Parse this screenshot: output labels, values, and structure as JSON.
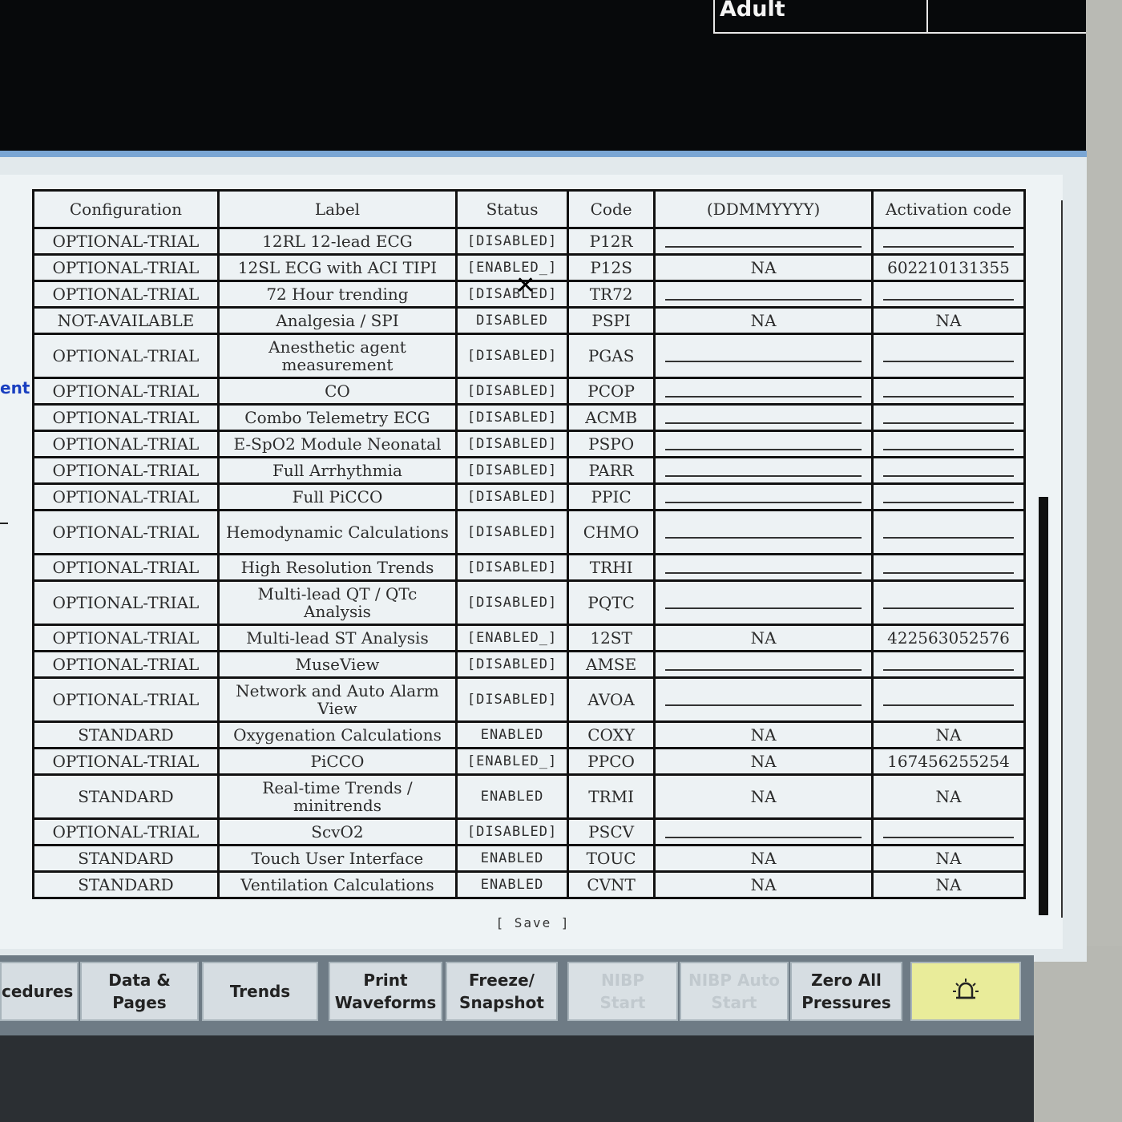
{
  "header": {
    "patient_type": "Adult"
  },
  "side": {
    "fragment": "ent"
  },
  "table": {
    "headers": {
      "configuration": "Configuration",
      "label": "Label",
      "status": "Status",
      "code": "Code",
      "expiration": "(DDMMYYYY)",
      "activation": "Activation code"
    },
    "rows": [
      {
        "config": "OPTIONAL-TRIAL",
        "label": "12RL 12-lead ECG",
        "status": "[DISABLED]",
        "code": "P12R",
        "expiration": "",
        "activation": ""
      },
      {
        "config": "OPTIONAL-TRIAL",
        "label": "12SL ECG with ACI TIPI",
        "status": "[ENABLED_]",
        "code": "P12S",
        "expiration": "NA",
        "activation": "602210131355"
      },
      {
        "config": "OPTIONAL-TRIAL",
        "label": "72 Hour trending",
        "status": "[DISABLED]",
        "code": "TR72",
        "expiration": "",
        "activation": ""
      },
      {
        "config": "NOT-AVAILABLE",
        "label": "Analgesia / SPI",
        "status": "DISABLED",
        "code": "PSPI",
        "expiration": "NA",
        "activation": "NA"
      },
      {
        "config": "OPTIONAL-TRIAL",
        "label": "Anesthetic agent measurement",
        "status": "[DISABLED]",
        "code": "PGAS",
        "expiration": "",
        "activation": ""
      },
      {
        "config": "OPTIONAL-TRIAL",
        "label": "CO",
        "status": "[DISABLED]",
        "code": "PCOP",
        "expiration": "",
        "activation": ""
      },
      {
        "config": "OPTIONAL-TRIAL",
        "label": "Combo Telemetry ECG",
        "status": "[DISABLED]",
        "code": "ACMB",
        "expiration": "",
        "activation": ""
      },
      {
        "config": "OPTIONAL-TRIAL",
        "label": "E-SpO2 Module Neonatal",
        "status": "[DISABLED]",
        "code": "PSPO",
        "expiration": "",
        "activation": ""
      },
      {
        "config": "OPTIONAL-TRIAL",
        "label": "Full Arrhythmia",
        "status": "[DISABLED]",
        "code": "PARR",
        "expiration": "",
        "activation": ""
      },
      {
        "config": "OPTIONAL-TRIAL",
        "label": "Full PiCCO",
        "status": "[DISABLED]",
        "code": "PPIC",
        "expiration": "",
        "activation": ""
      },
      {
        "config": "OPTIONAL-TRIAL",
        "label": "Hemodynamic Calculations",
        "status": "[DISABLED]",
        "code": "CHMO",
        "expiration": "",
        "activation": ""
      },
      {
        "config": "OPTIONAL-TRIAL",
        "label": "High Resolution Trends",
        "status": "[DISABLED]",
        "code": "TRHI",
        "expiration": "",
        "activation": ""
      },
      {
        "config": "OPTIONAL-TRIAL",
        "label": "Multi-lead QT / QTc Analysis",
        "status": "[DISABLED]",
        "code": "PQTC",
        "expiration": "",
        "activation": ""
      },
      {
        "config": "OPTIONAL-TRIAL",
        "label": "Multi-lead ST Analysis",
        "status": "[ENABLED_]",
        "code": "12ST",
        "expiration": "NA",
        "activation": "422563052576"
      },
      {
        "config": "OPTIONAL-TRIAL",
        "label": "MuseView",
        "status": "[DISABLED]",
        "code": "AMSE",
        "expiration": "",
        "activation": ""
      },
      {
        "config": "OPTIONAL-TRIAL",
        "label": "Network and Auto Alarm View",
        "status": "[DISABLED]",
        "code": "AVOA",
        "expiration": "",
        "activation": ""
      },
      {
        "config": "STANDARD",
        "label": "Oxygenation Calculations",
        "status": "ENABLED",
        "code": "COXY",
        "expiration": "NA",
        "activation": "NA"
      },
      {
        "config": "OPTIONAL-TRIAL",
        "label": "PiCCO",
        "status": "[ENABLED_]",
        "code": "PPCO",
        "expiration": "NA",
        "activation": "167456255254"
      },
      {
        "config": "STANDARD",
        "label": "Real-time Trends / minitrends",
        "status": "ENABLED",
        "code": "TRMI",
        "expiration": "NA",
        "activation": "NA"
      },
      {
        "config": "OPTIONAL-TRIAL",
        "label": "ScvO2",
        "status": "[DISABLED]",
        "code": "PSCV",
        "expiration": "",
        "activation": ""
      },
      {
        "config": "STANDARD",
        "label": "Touch User Interface",
        "status": "ENABLED",
        "code": "TOUC",
        "expiration": "NA",
        "activation": "NA"
      },
      {
        "config": "STANDARD",
        "label": "Ventilation Calculations",
        "status": "ENABLED",
        "code": "CVNT",
        "expiration": "NA",
        "activation": "NA"
      }
    ]
  },
  "dialog": {
    "save_label": "[ Save ]"
  },
  "toolbar": {
    "buttons": [
      {
        "label": "cedures",
        "enabled": true
      },
      {
        "label": "Data &\nPages",
        "enabled": true
      },
      {
        "label": "Trends",
        "enabled": true
      },
      {
        "label": "Print\nWaveforms",
        "enabled": true
      },
      {
        "label": "Freeze/\nSnapshot",
        "enabled": true
      },
      {
        "label": "NIBP\nStart",
        "enabled": false
      },
      {
        "label": "NIBP Auto\nStart",
        "enabled": false
      },
      {
        "label": "Zero All\nPressures",
        "enabled": true
      }
    ],
    "alarm_icon": "alarm-bell-icon"
  },
  "colors": {
    "dialog_bg": "#eef3f5",
    "title_bar": "#7aa6d4",
    "alarm_button": "#e9ec9a",
    "side_link": "#1a3fc0"
  }
}
